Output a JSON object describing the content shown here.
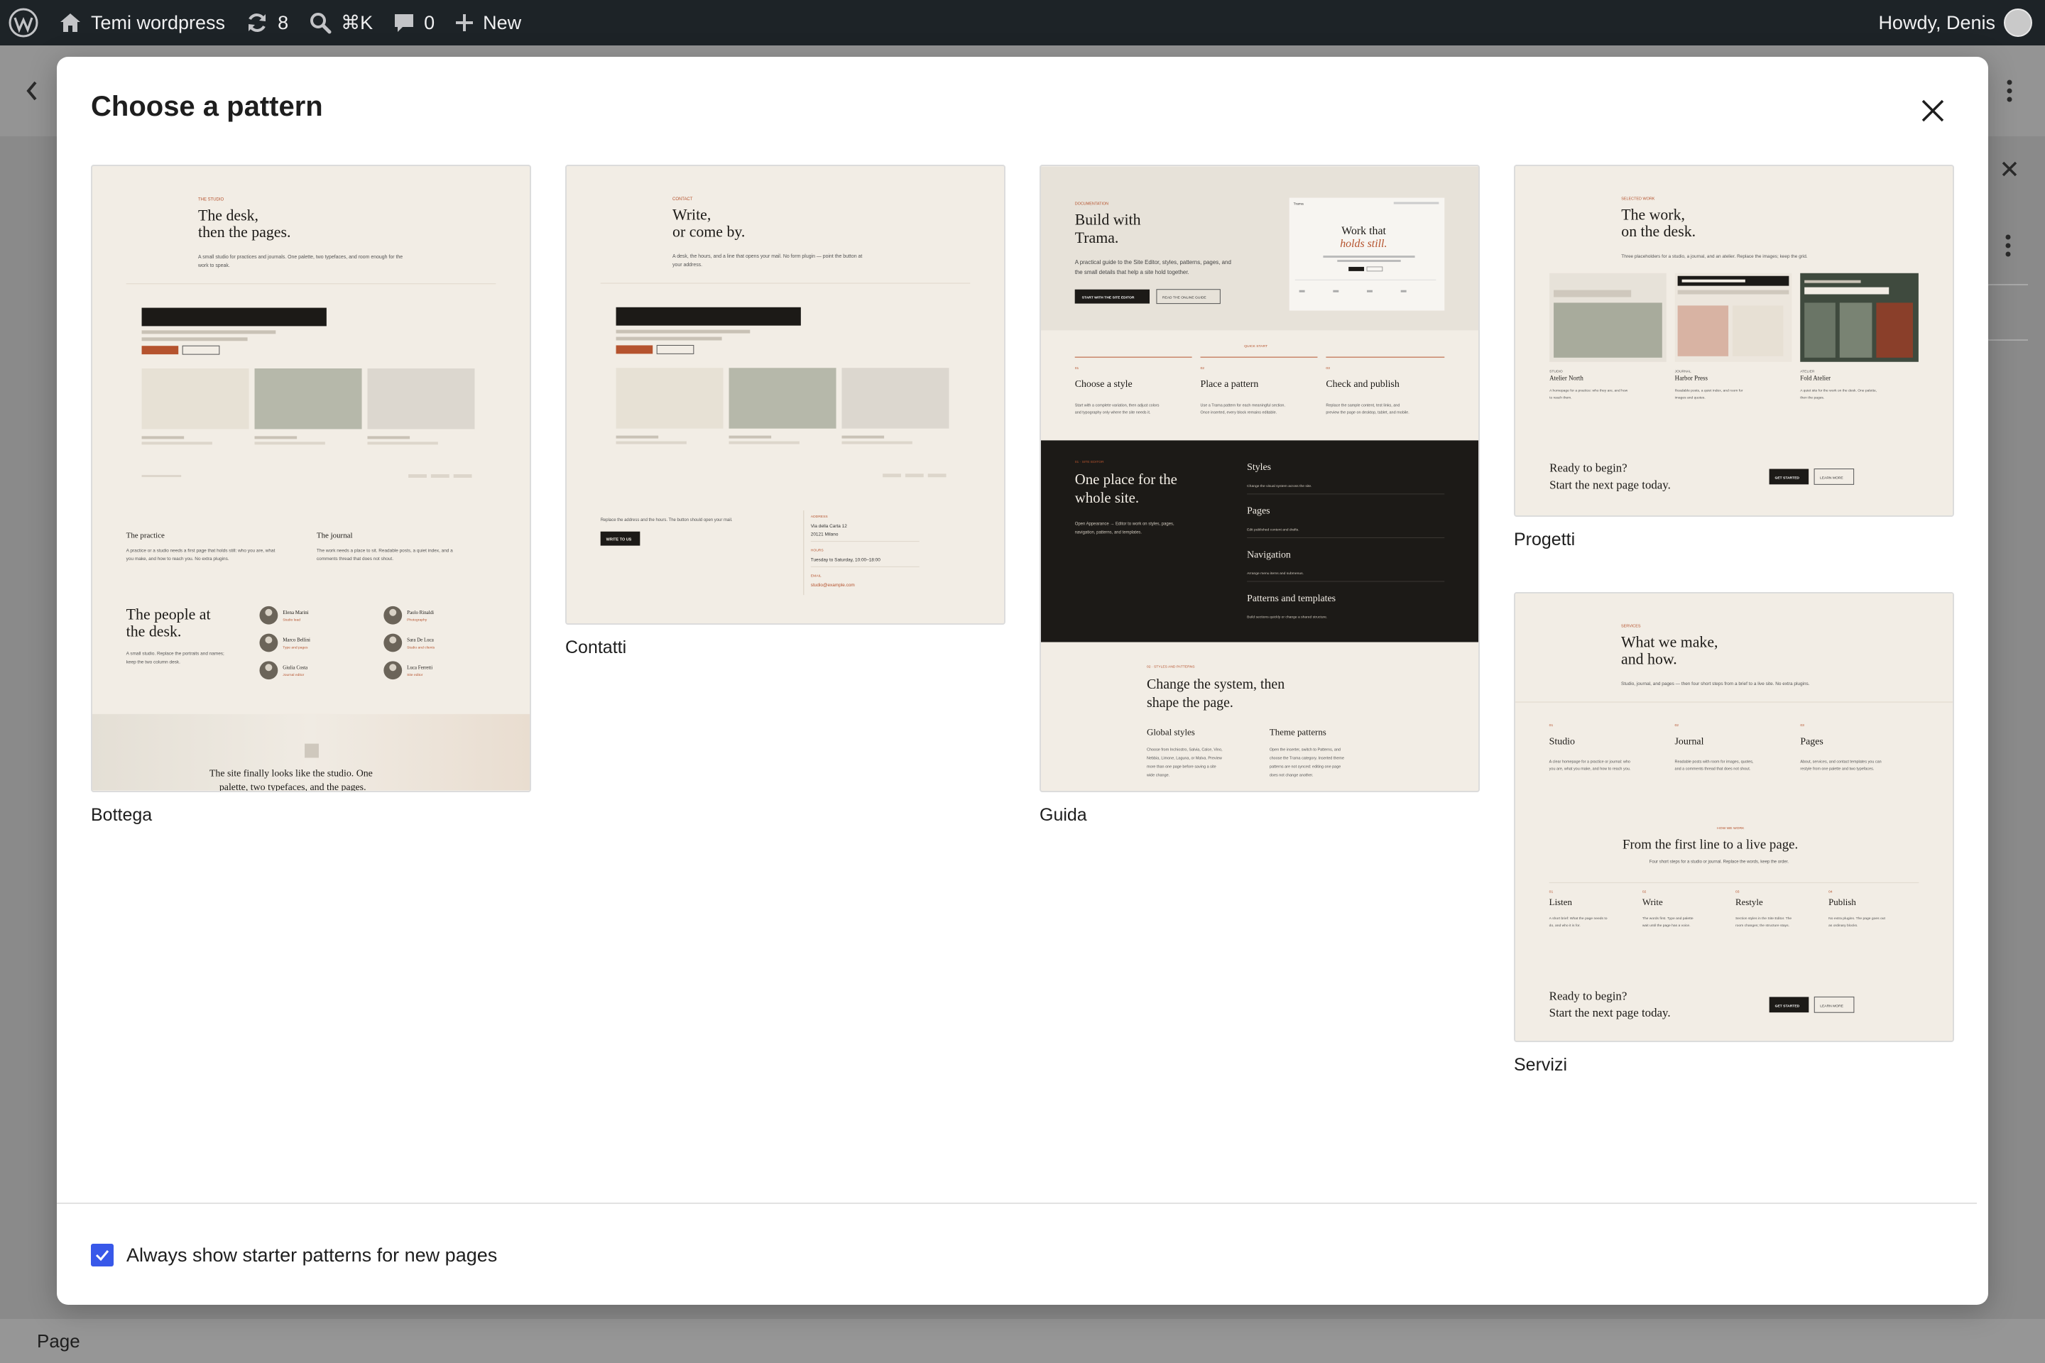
{
  "admin_bar": {
    "site_name": "Temi wordpress",
    "updates_count": "8",
    "search_shortcut": "⌘K",
    "comments_count": "0",
    "new_label": "New",
    "greeting": "Howdy, Denis"
  },
  "modal": {
    "title": "Choose a pattern",
    "checkbox_label": "Always show starter patterns for new pages",
    "checkbox_checked": true,
    "accent_color": "#3858e9"
  },
  "patterns": [
    {
      "label": "Bottega"
    },
    {
      "label": "Contatti"
    },
    {
      "label": "Guida"
    },
    {
      "label": "Progetti"
    },
    {
      "label": "Servizi"
    }
  ],
  "thumbs": {
    "bottega": {
      "eyebrow": "THE STUDIO",
      "title_1": "The desk,",
      "title_2": "then the pages.",
      "intro_1": "A small studio for practices and journals. One palette, two typefaces, and room enough for the",
      "intro_2": "work to speak.",
      "col1_title": "The practice",
      "col1_text_1": "A practice or a studio needs a first page that holds still: who you are, what",
      "col1_text_2": "you make, and how to reach you. No extra plugins.",
      "col2_title": "The journal",
      "col2_text_1": "The work needs a place to sit. Readable posts, a quiet index, and a",
      "col2_text_2": "comments thread that does not shout.",
      "people_title_1": "The people at",
      "people_title_2": "the desk.",
      "people_text_1": "A small studio. Replace the portraits and names;",
      "people_text_2": "keep the two column desk.",
      "people": [
        {
          "name": "Elena Marini",
          "role": "Studio lead"
        },
        {
          "name": "Paolo Rinaldi",
          "role": "Photography"
        },
        {
          "name": "Marco Bellini",
          "role": "Type and pages"
        },
        {
          "name": "Sara De Luca",
          "role": "Studio and clients"
        },
        {
          "name": "Giulia Costa",
          "role": "Journal editor"
        },
        {
          "name": "Luca Ferretti",
          "role": "Site editor"
        }
      ],
      "quote_1": "The site finally looks like the studio. One",
      "quote_2": "palette, two typefaces, and the pages."
    },
    "contatti": {
      "eyebrow": "CONTACT",
      "title_1": "Write,",
      "title_2": "or come by.",
      "intro_1": "A desk, the hours, and a line that opens your mail. No form plugin — point the button at",
      "intro_2": "your address.",
      "note": "Replace the address and the hours. The button should open your mail.",
      "button": "WRITE TO US",
      "address_label": "ADDRESS",
      "address_1": "Via della Carta 12",
      "address_2": "20121 Milano",
      "hours_label": "HOURS",
      "hours": "Tuesday to Saturday, 10:00–18:00",
      "email_label": "EMAIL",
      "email": "studio@example.com"
    },
    "guida": {
      "eyebrow": "DOCUMENTATION",
      "title_1": "Build with",
      "title_2": "Trama.",
      "intro_1": "A practical guide to the Site Editor, styles, patterns, pages, and",
      "intro_2": "the small details that help a site hold together.",
      "btn_primary": "START WITH THE SITE EDITOR",
      "btn_secondary": "READ THE ONLINE GUIDE",
      "preview_brand": "Trama",
      "preview_title_1": "Work that",
      "preview_title_2": "holds still.",
      "quick_label": "QUICK START",
      "steps": [
        {
          "num": "01",
          "title": "Choose a style",
          "text_1": "Start with a complete variation, then adjust colors",
          "text_2": "and typography only where the site needs it."
        },
        {
          "num": "02",
          "title": "Place a pattern",
          "text_1": "Use a Trama pattern for each meaningful section.",
          "text_2": "Once inserted, every block remains editable."
        },
        {
          "num": "03",
          "title": "Check and publish",
          "text_1": "Replace the sample content, test links, and",
          "text_2": "preview the page on desktop, tablet, and mobile."
        }
      ],
      "dark_eyebrow": "01 · SITE EDITOR",
      "dark_title_1": "One place for the",
      "dark_title_2": "whole site.",
      "dark_text_1": "Open Appearance → Editor to work on styles, pages,",
      "dark_text_2": "navigation, patterns, and templates.",
      "dark_items": [
        {
          "title": "Styles",
          "text": "Change the visual system across the site."
        },
        {
          "title": "Pages",
          "text": "Edit published content and drafts."
        },
        {
          "title": "Navigation",
          "text": "Arrange menu items and submenus."
        },
        {
          "title": "Patterns and templates",
          "text": "Build sections quickly or change a shared structure."
        }
      ],
      "lower_eyebrow": "02 · STYLES AND PATTERNS",
      "lower_title_1": "Change the system, then",
      "lower_title_2": "shape the page.",
      "lower_col1_title": "Global styles",
      "lower_col1_text": [
        "Choose from Inchiostro, Salvia, Calce, Vino,",
        "Nebbia, Limone, Laguna, or Malva. Preview",
        "more than one page before saving a site",
        "wide change."
      ],
      "lower_col2_title": "Theme patterns",
      "lower_col2_text": [
        "Open the inserter, switch to Patterns, and",
        "choose the Trama category. Inserted theme",
        "patterns are not synced: editing one page",
        "does not change another."
      ]
    },
    "progetti": {
      "eyebrow": "SELECTED WORK",
      "title_1": "The work,",
      "title_2": "on the desk.",
      "intro": "Three placeholders for a studio, a journal, and an atelier. Replace the images; keep the grid.",
      "projects": [
        {
          "tag": "STUDIO",
          "name": "Atelier North",
          "text_1": "A homepage for a practice: who they are, and how",
          "text_2": "to reach them."
        },
        {
          "tag": "JOURNAL",
          "name": "Harbor Press",
          "text_1": "Readable posts, a quiet index, and room for",
          "text_2": "images and quotes."
        },
        {
          "tag": "ATELIER",
          "name": "Fold Atelier",
          "text_1": "A quiet site for the work on the desk. One palette,",
          "text_2": "then the pages."
        }
      ],
      "cta_1": "Ready to begin?",
      "cta_2": "Start the next page today.",
      "btn_primary": "GET STARTED",
      "btn_secondary": "LEARN MORE"
    },
    "servizi": {
      "eyebrow": "SERVICES",
      "title_1": "What we make,",
      "title_2": "and how.",
      "intro": "Studio, journal, and pages — then four short steps from a brief to a live site. No extra plugins.",
      "services": [
        {
          "num": "01",
          "title": "Studio",
          "text_1": "A clear homepage for a practice or journal: who",
          "text_2": "you are, what you make, and how to reach you."
        },
        {
          "num": "02",
          "title": "Journal",
          "text_1": "Readable posts with room for images, quotes,",
          "text_2": "and a comments thread that does not shout."
        },
        {
          "num": "03",
          "title": "Pages",
          "text_1": "About, services, and contact templates you can",
          "text_2": "restyle from one palette and two typefaces."
        }
      ],
      "how_eyebrow": "HOW WE WORK",
      "how_title": "From the first line to a live page.",
      "how_intro": "Four short steps for a studio or journal. Replace the words, keep the order.",
      "steps": [
        {
          "num": "01",
          "title": "Listen",
          "text_1": "A short brief: What the page needs to",
          "text_2": "do, and who it is for."
        },
        {
          "num": "02",
          "title": "Write",
          "text_1": "The words first. Type and palette",
          "text_2": "wait until the page has a voice."
        },
        {
          "num": "03",
          "title": "Restyle",
          "text_1": "Section styles in the Site Editor. The",
          "text_2": "room changes; the structure stays."
        },
        {
          "num": "04",
          "title": "Publish",
          "text_1": "No extra plugins. The page goes out",
          "text_2": "as ordinary blocks."
        }
      ],
      "cta_1": "Ready to begin?",
      "cta_2": "Start the next page today.",
      "btn_primary": "GET STARTED",
      "btn_secondary": "LEARN MORE"
    }
  },
  "editor_footer": {
    "breadcrumb": "Page"
  }
}
